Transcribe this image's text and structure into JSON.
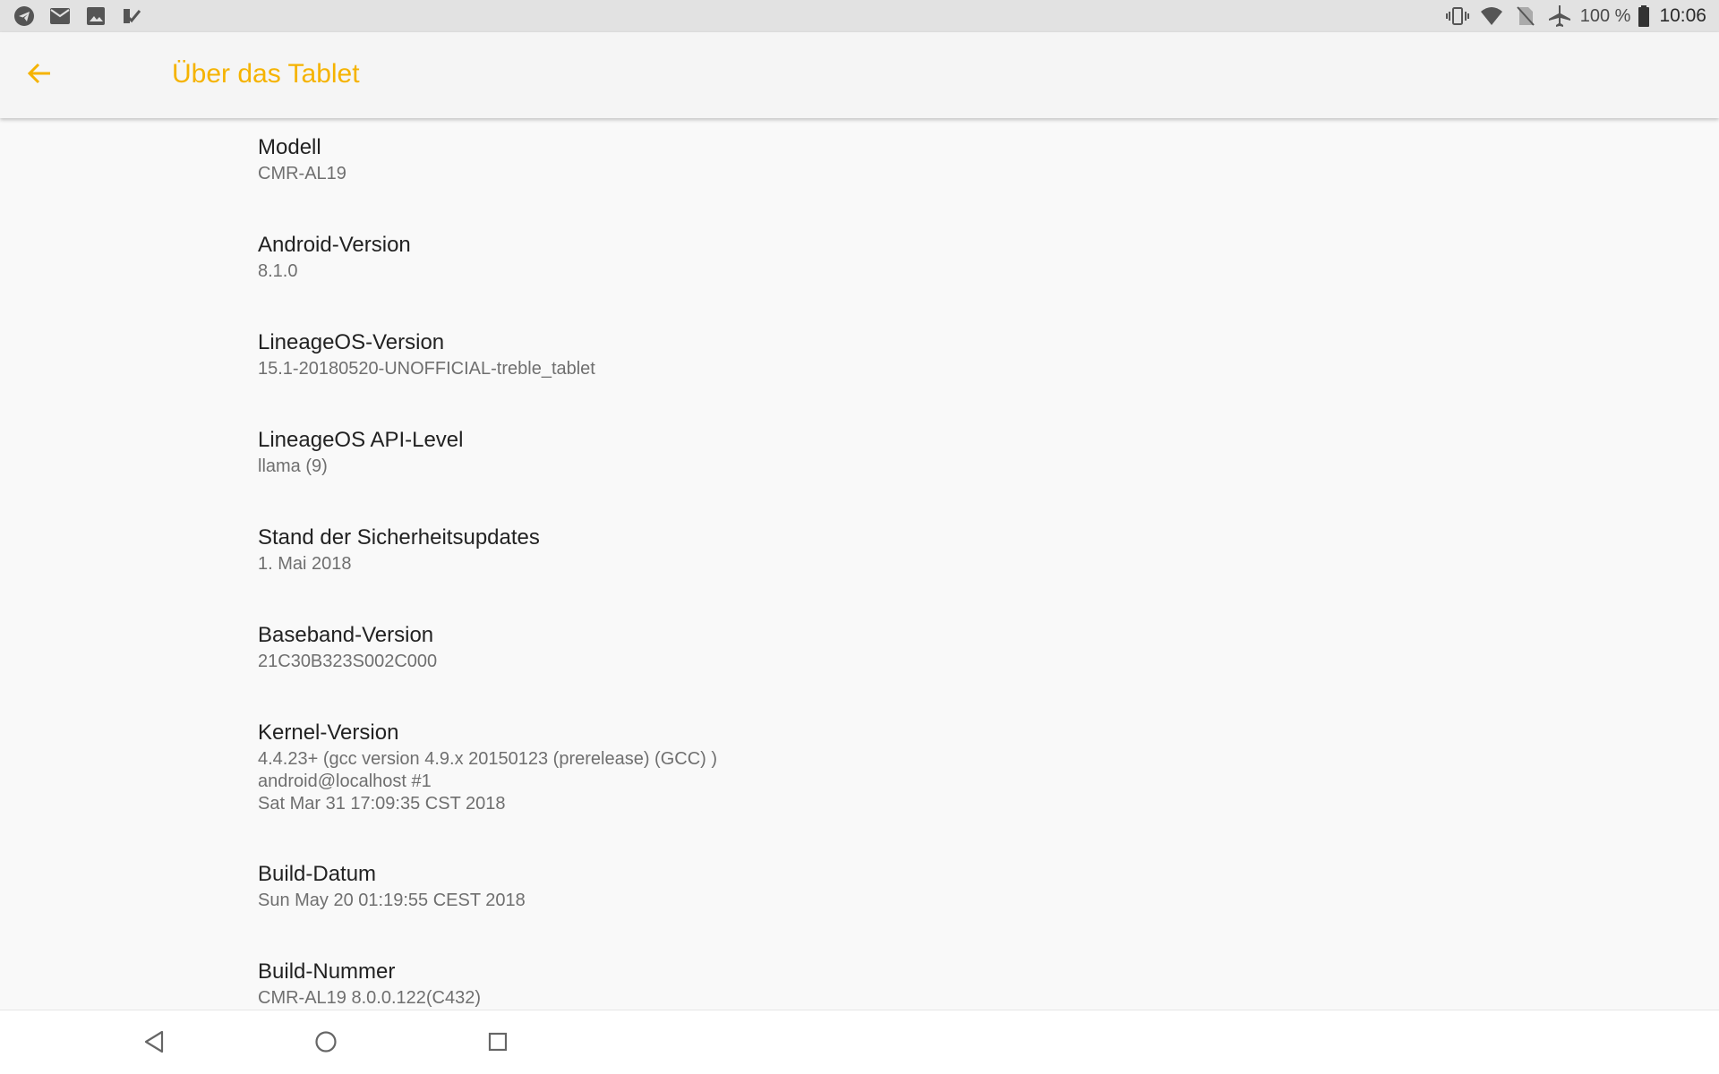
{
  "status_bar": {
    "left_icons": [
      "telegram-icon",
      "mail-icon",
      "image-icon",
      "task-check-icon"
    ],
    "right_icons": [
      "vibrate-icon",
      "wifi-icon",
      "no-sim-icon",
      "airplane-icon",
      "battery-icon"
    ],
    "battery_label": "100 %",
    "time": "10:06"
  },
  "app_bar": {
    "title": "Über das Tablet",
    "accent_color": "#f5b300",
    "back_icon": "arrow-left-icon"
  },
  "items": [
    {
      "title": "Modell",
      "value": "CMR-AL19"
    },
    {
      "title": "Android-Version",
      "value": "8.1.0"
    },
    {
      "title": "LineageOS-Version",
      "value": "15.1-20180520-UNOFFICIAL-treble_tablet"
    },
    {
      "title": "LineageOS API-Level",
      "value": "llama (9)"
    },
    {
      "title": "Stand der Sicherheitsupdates",
      "value": "1. Mai 2018"
    },
    {
      "title": "Baseband-Version",
      "value": "21C30B323S002C000"
    },
    {
      "title": "Kernel-Version",
      "value_lines": [
        "4.4.23+ (gcc version 4.9.x 20150123 (prerelease) (GCC) )",
        "android@localhost #1",
        "Sat Mar 31 17:09:35 CST 2018"
      ]
    },
    {
      "title": "Build-Datum",
      "value": "Sun May 20 01:19:55 CEST 2018"
    },
    {
      "title": "Build-Nummer",
      "value": "CMR-AL19 8.0.0.122(C432)"
    }
  ],
  "nav_bar": {
    "buttons": [
      "back-triangle-icon",
      "home-circle-icon",
      "recents-square-icon"
    ]
  }
}
